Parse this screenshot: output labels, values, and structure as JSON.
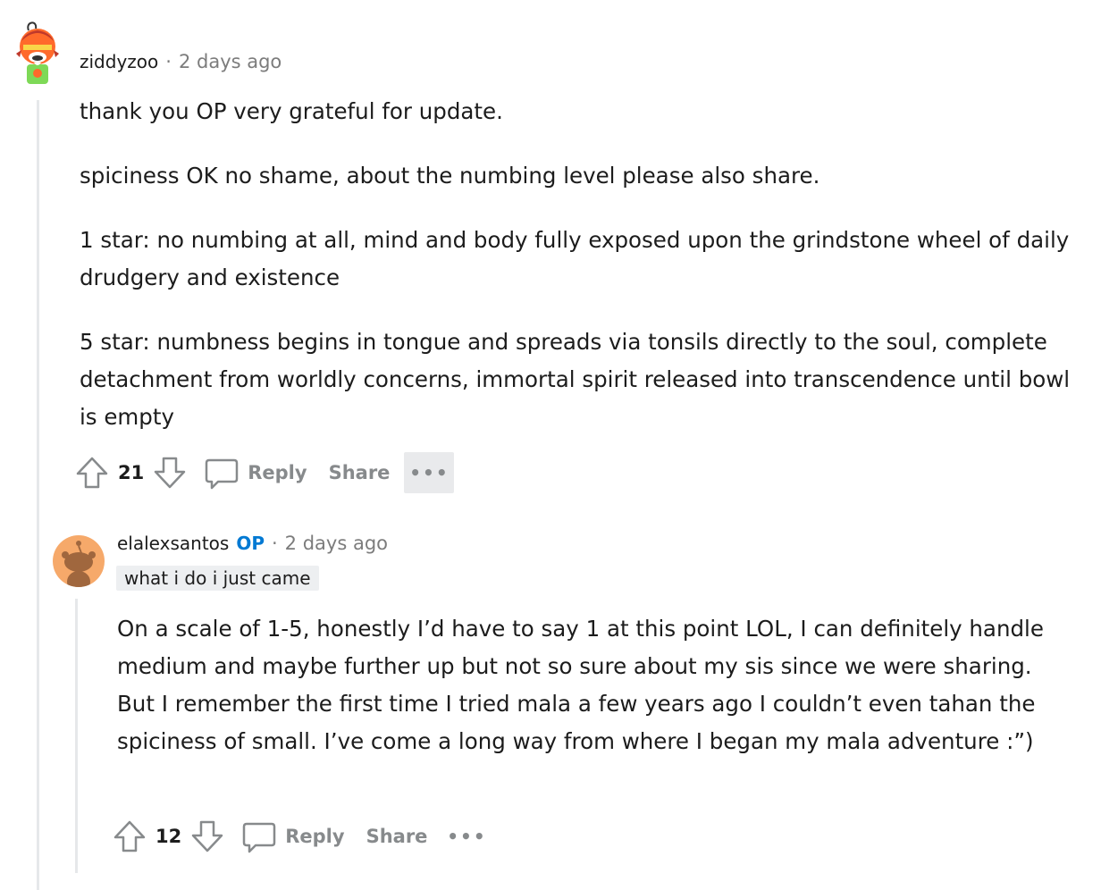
{
  "comment1": {
    "username": "ziddyzoo",
    "separator": "·",
    "time": "2 days ago",
    "paragraphs": [
      "thank you OP very grateful for update.",
      "spiciness OK no shame, about the numbing level please also share.",
      "1 star: no numbing at all, mind and body fully exposed upon the grindstone wheel of daily drudgery and existence",
      "5 star: numbness begins in tongue and spreads via tonsils directly to the soul, complete detachment from worldly concerns, immortal spirit released into transcendence until bowl is empty"
    ],
    "votes": "21",
    "reply_label": "Reply",
    "share_label": "Share",
    "more_label": "•••"
  },
  "comment2": {
    "username": "elalexsantos",
    "op_badge": "OP",
    "separator": "·",
    "time": "2 days ago",
    "flair": "what i do i just came",
    "paragraphs": [
      "On a scale of 1-5, honestly I’d have to say 1 at this point LOL, I can definitely handle medium and maybe further up but not so sure about my sis since we were sharing. But I remember the first time I tried mala a few years ago I couldn’t even tahan the spiciness of small. I’ve come a long way from where I began my mala adventure :”)"
    ],
    "votes": "12",
    "reply_label": "Reply",
    "share_label": "Share",
    "more_label": "•••"
  },
  "colors": {
    "op_accent": "#0079d3",
    "meta_gray": "#7c7c7c",
    "action_gray": "#878a8c",
    "thread_line": "#e6e8ea"
  }
}
